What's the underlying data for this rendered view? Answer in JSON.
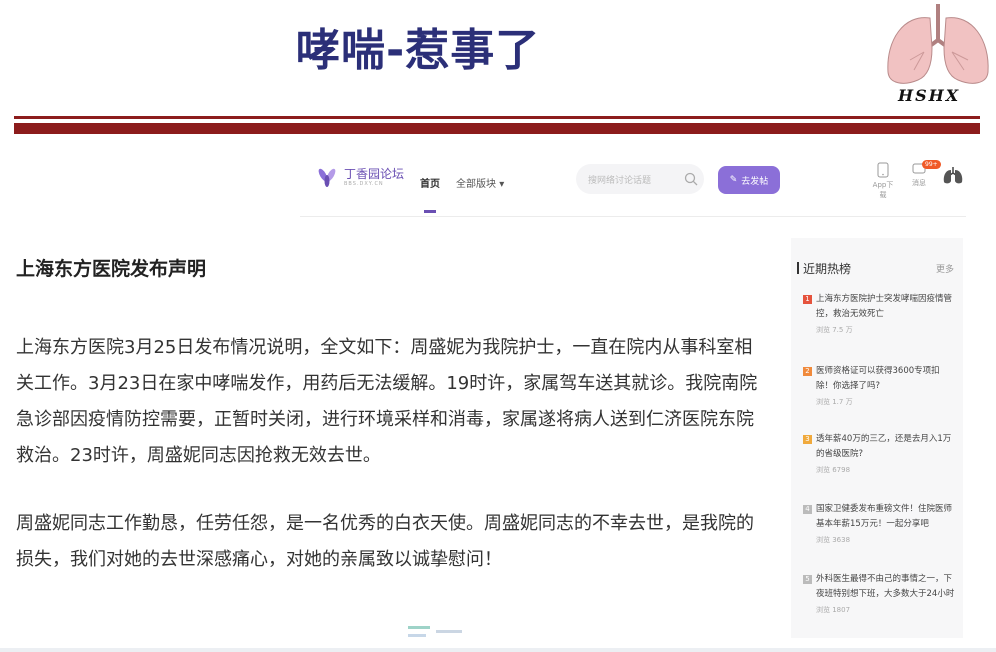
{
  "slide": {
    "title": "哮喘-惹事了",
    "logo_text": "HSHX"
  },
  "nav": {
    "brand_name": "丁香园论坛",
    "brand_sub": "BBS.DXY.CN",
    "home": "首页",
    "all_sections": "全部版块",
    "search_placeholder": "搜网络讨论话题",
    "post_button": "去发帖",
    "app_label": "App下载",
    "msg_label": "消息",
    "msg_badge": "99+"
  },
  "article": {
    "title": "上海东方医院发布声明",
    "p1": "上海东方医院3月25日发布情况说明，全文如下：周盛妮为我院护士，一直在院内从事科室相关工作。3月23日在家中哮喘发作，用药后无法缓解。19时许，家属驾车送其就诊。我院南院急诊部因疫情防控需要，正暂时关闭，进行环境采样和消毒，家属遂将病人送到仁济医院东院救治。23时许，周盛妮同志因抢救无效去世。",
    "p2": "周盛妮同志工作勤恳，任劳任怨，是一名优秀的白衣天使。周盛妮同志的不幸去世，是我院的损失，我们对她的去世深感痛心，对她的亲属致以诚挚慰问！"
  },
  "sidebar": {
    "heading": "近期热榜",
    "more": "更多",
    "items": [
      {
        "rank": "1",
        "color": "#e5533d",
        "text": "上海东方医院护士突发哮喘因疫情管控，救治无效死亡",
        "meta": "浏览 7.5 万"
      },
      {
        "rank": "2",
        "color": "#f08a3c",
        "text": "医师资格证可以获得3600专项扣除！你选择了吗?",
        "meta": "浏览 1.7 万"
      },
      {
        "rank": "3",
        "color": "#f0a93c",
        "text": "透年薪40万的三乙，还是去月入1万的省级医院?",
        "meta": "浏览 6798"
      },
      {
        "rank": "4",
        "color": "#bbbbbb",
        "text": "国家卫健委发布重磅文件！住院医师基本年薪15万元！一起分享吧",
        "meta": "浏览 3638"
      },
      {
        "rank": "5",
        "color": "#bbbbbb",
        "text": "外科医生最得不由己的事情之一，下夜班特别想下班，大多数大于24小时",
        "meta": "浏览 1807"
      }
    ]
  }
}
